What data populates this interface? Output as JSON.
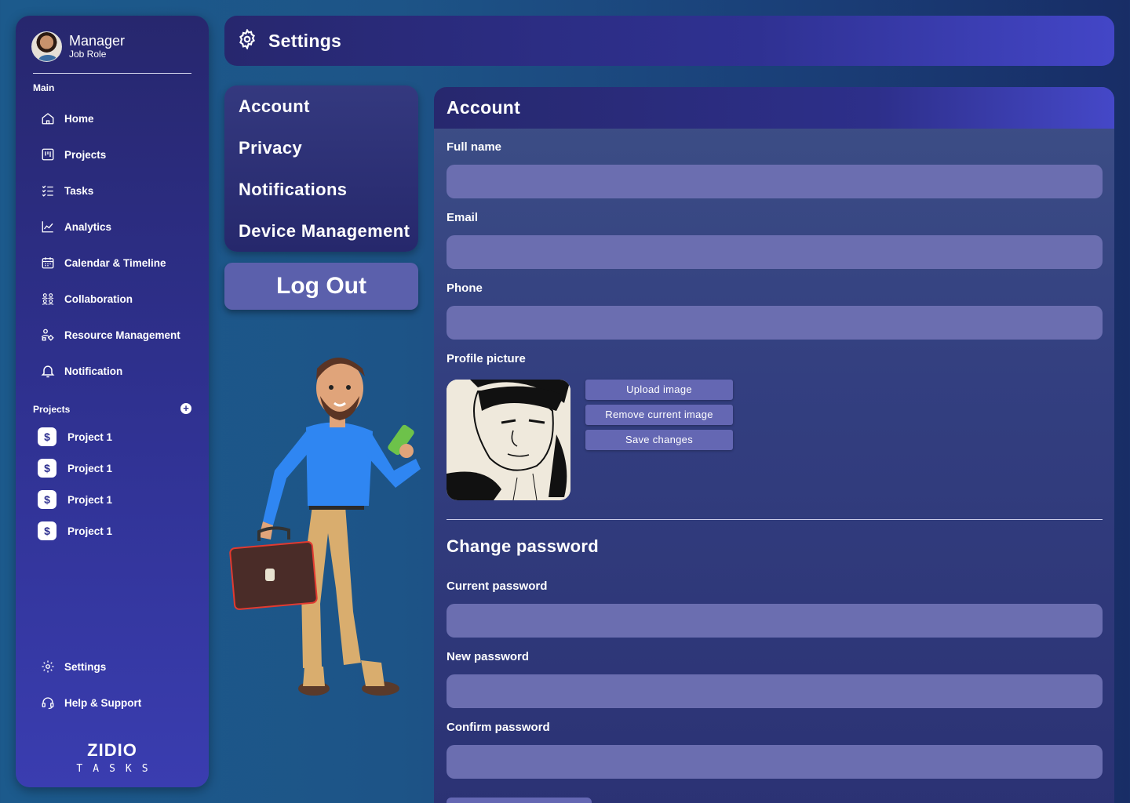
{
  "profile": {
    "name": "Manager",
    "role": "Job Role"
  },
  "sidebar": {
    "main_label": "Main",
    "items": [
      {
        "label": "Home",
        "icon": "home-icon"
      },
      {
        "label": "Projects",
        "icon": "projects-icon"
      },
      {
        "label": "Tasks",
        "icon": "tasks-icon"
      },
      {
        "label": "Analytics",
        "icon": "analytics-icon"
      },
      {
        "label": "Calendar & Timeline",
        "icon": "calendar-icon"
      },
      {
        "label": "Collaboration",
        "icon": "collaboration-icon"
      },
      {
        "label": "Resource Management",
        "icon": "resource-icon"
      },
      {
        "label": "Notification",
        "icon": "bell-icon"
      }
    ],
    "projects_label": "Projects",
    "projects": [
      {
        "label": "Project 1"
      },
      {
        "label": "Project 1"
      },
      {
        "label": "Project 1"
      },
      {
        "label": "Project 1"
      }
    ],
    "bottom": [
      {
        "label": "Settings",
        "icon": "gear-icon"
      },
      {
        "label": "Help & Support",
        "icon": "headset-icon"
      }
    ]
  },
  "logo": {
    "line1": "ZIDIO",
    "line2": "TASKS"
  },
  "header": {
    "title": "Settings"
  },
  "settings_menu": {
    "items": [
      "Account",
      "Privacy",
      "Notifications",
      "Device Management"
    ],
    "logout": "Log Out"
  },
  "account": {
    "title": "Account",
    "full_name_label": "Full name",
    "email_label": "Email",
    "phone_label": "Phone",
    "profile_picture_label": "Profile picture",
    "upload_button": "Upload image",
    "remove_button": "Remove current image",
    "save_button": "Save changes",
    "change_password_title": "Change password",
    "current_password_label": "Current password",
    "new_password_label": "New password",
    "confirm_password_label": "Confirm password"
  },
  "colors": {
    "sidebar": "#2f3190",
    "accent": "#4346c7",
    "input": "#6b6eb0",
    "button": "#6467b3"
  }
}
